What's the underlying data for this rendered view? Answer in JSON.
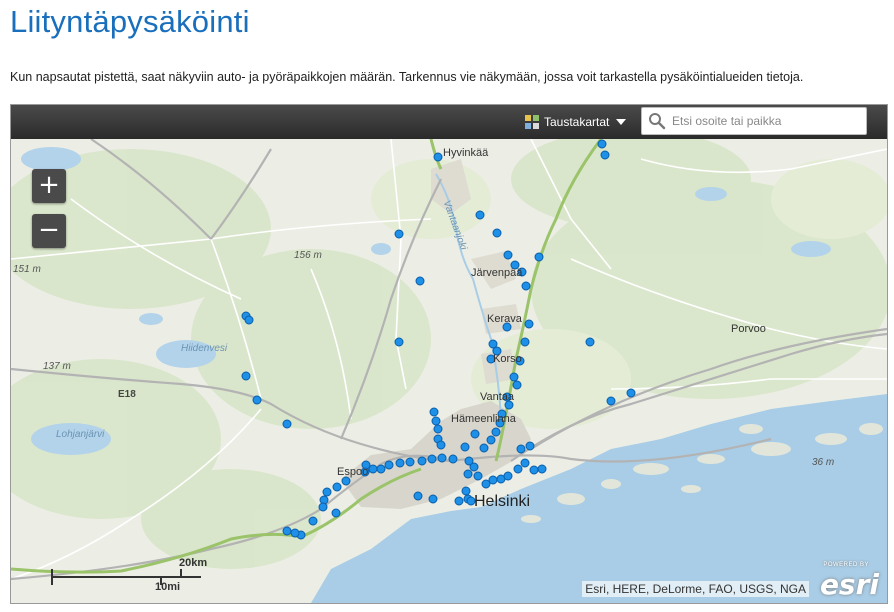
{
  "page": {
    "title": "Liityntäpysäköinti",
    "intro": "Kun napsautat pistettä, saat näkyviin auto- ja pyöräpaikkojen määrän. Tarkennus vie näkymään, jossa voit tarkastella pysäköintialueiden tietoja."
  },
  "toolbar": {
    "basemap_label": "Taustakartat",
    "search_placeholder": "Etsi osoite tai paikka"
  },
  "zoom": {
    "in_label": "+",
    "out_label": "−"
  },
  "map": {
    "labels": {
      "hyvinkaa": "Hyvinkää",
      "vantaanjoki": "Vantaanjoki",
      "jarvenpaa": "Järvenpää",
      "kerava": "Kerava",
      "korso": "Korso",
      "vantaa": "Vantaa",
      "hameenlinna": "Hämeenlinna",
      "espoo": "Espoo",
      "helsinki": "Helsinki",
      "porvoo": "Porvoo",
      "hiidenvesi": "Hiidenvesi",
      "lohjanjarvi": "Lohjanjärvi",
      "e18": "E18",
      "elev_151": "151 m",
      "elev_156": "156 m",
      "elev_137": "137 m",
      "elev_36": "36 m"
    },
    "parking_point_color": "#1e90e8",
    "motorway_color": "#9ac36a",
    "water_color": "#a9cde6"
  },
  "scale": {
    "km_label": "20km",
    "mi_label": "10mi"
  },
  "attribution": "Esri, HERE, DeLorme, FAO, USGS, NGA",
  "logo": {
    "powered": "POWERED BY",
    "word": "esri"
  }
}
